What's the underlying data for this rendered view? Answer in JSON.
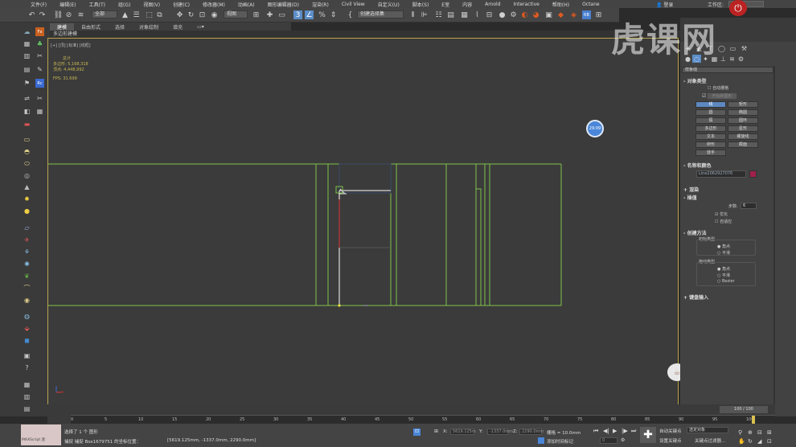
{
  "menu": {
    "items": [
      "文件(F)",
      "编辑(E)",
      "工具(T)",
      "组(G)",
      "视图(V)",
      "创建(C)",
      "修改器(M)",
      "动画(A)",
      "图形编辑器(D)",
      "渲染(R)",
      "Civil View",
      "自定义(U)",
      "脚本(S)",
      "E室",
      "内容",
      "Arnold",
      "Interactive",
      "帮助(H)",
      "Octane"
    ],
    "login": "登录",
    "workspace": "工作区:"
  },
  "toolbar": {
    "selection_filter": "全部",
    "reference_coord": "视图",
    "named_selection": "创建选择集"
  },
  "ribbon": {
    "tabs": [
      "建模",
      "自由形式",
      "选择",
      "对象绘制",
      "填充"
    ],
    "sub_label": "多边形建模"
  },
  "viewport": {
    "label": "[+] [顶] [标准] [线框]",
    "stats": {
      "total_label": "总计",
      "polys_label": "多边形:",
      "polys_value": "5,168,318",
      "verts_label": "顶点:",
      "verts_value": "4,448,992",
      "fps_label": "FPS:",
      "fps_value": "31.699"
    },
    "timer_badge": "29:09",
    "axis_label": "x"
  },
  "command_panel": {
    "category_dropdown": "样条线",
    "object_type": {
      "title": "对象类型",
      "auto_grid": "自动栅格",
      "start_new_shape": "开始新图形",
      "buttons": [
        "线",
        "矩形",
        "圆",
        "椭圆",
        "弧",
        "圆环",
        "多边形",
        "星形",
        "文本",
        "螺旋线",
        "卵形",
        "截面",
        "徒手"
      ]
    },
    "name_color": {
      "title": "名称和颜色",
      "name_value": "Line2062927076",
      "color": "#a0204a"
    },
    "render": {
      "title": "渲染"
    },
    "interpolation": {
      "title": "插值",
      "steps_label": "步数:",
      "steps_value": "6",
      "optimize": "优化",
      "adaptive": "自适应"
    },
    "creation_method": {
      "title": "创建方法",
      "initial_type": "初始类型",
      "initial_options": [
        "角点",
        "平滑"
      ],
      "drag_type": "拖动类型",
      "drag_options": [
        "角点",
        "平滑",
        "Bezier"
      ]
    },
    "keyboard_entry": {
      "title": "键盘输入"
    }
  },
  "timeline": {
    "frame_display": "100 / 100",
    "ticks": [
      "0",
      "5",
      "10",
      "15",
      "20",
      "25",
      "30",
      "35",
      "40",
      "45",
      "50",
      "55",
      "60",
      "65",
      "70",
      "75",
      "80",
      "85",
      "90",
      "95",
      "100"
    ]
  },
  "status": {
    "maxscript": "MAXScript 迷",
    "selected": "选择了 1 个 图形",
    "snap_info": "捕捉 捕捉 Box1679751 的坐标位置：",
    "coords": "[5619.125mm, -1337.0mm, 2290.0mm]",
    "x_field": "5619.125m",
    "y_field": "-1337.0mm",
    "z_field": "2290.0mm",
    "grid": "栅格 = 10.0mm",
    "add_time_tag": "添加时间标记",
    "auto_key": "自动关键点",
    "selected_object": "选定对象",
    "set_key": "设置关键点",
    "key_filters": "关键点过滤器...",
    "frame_value": "0"
  },
  "watermark": "虎课网",
  "colors": {
    "accent_blue": "#5b8dc8",
    "spline_green": "#7fc34a",
    "stats_yellow": "#c8b650",
    "viewport_border": "#b7a24a"
  }
}
